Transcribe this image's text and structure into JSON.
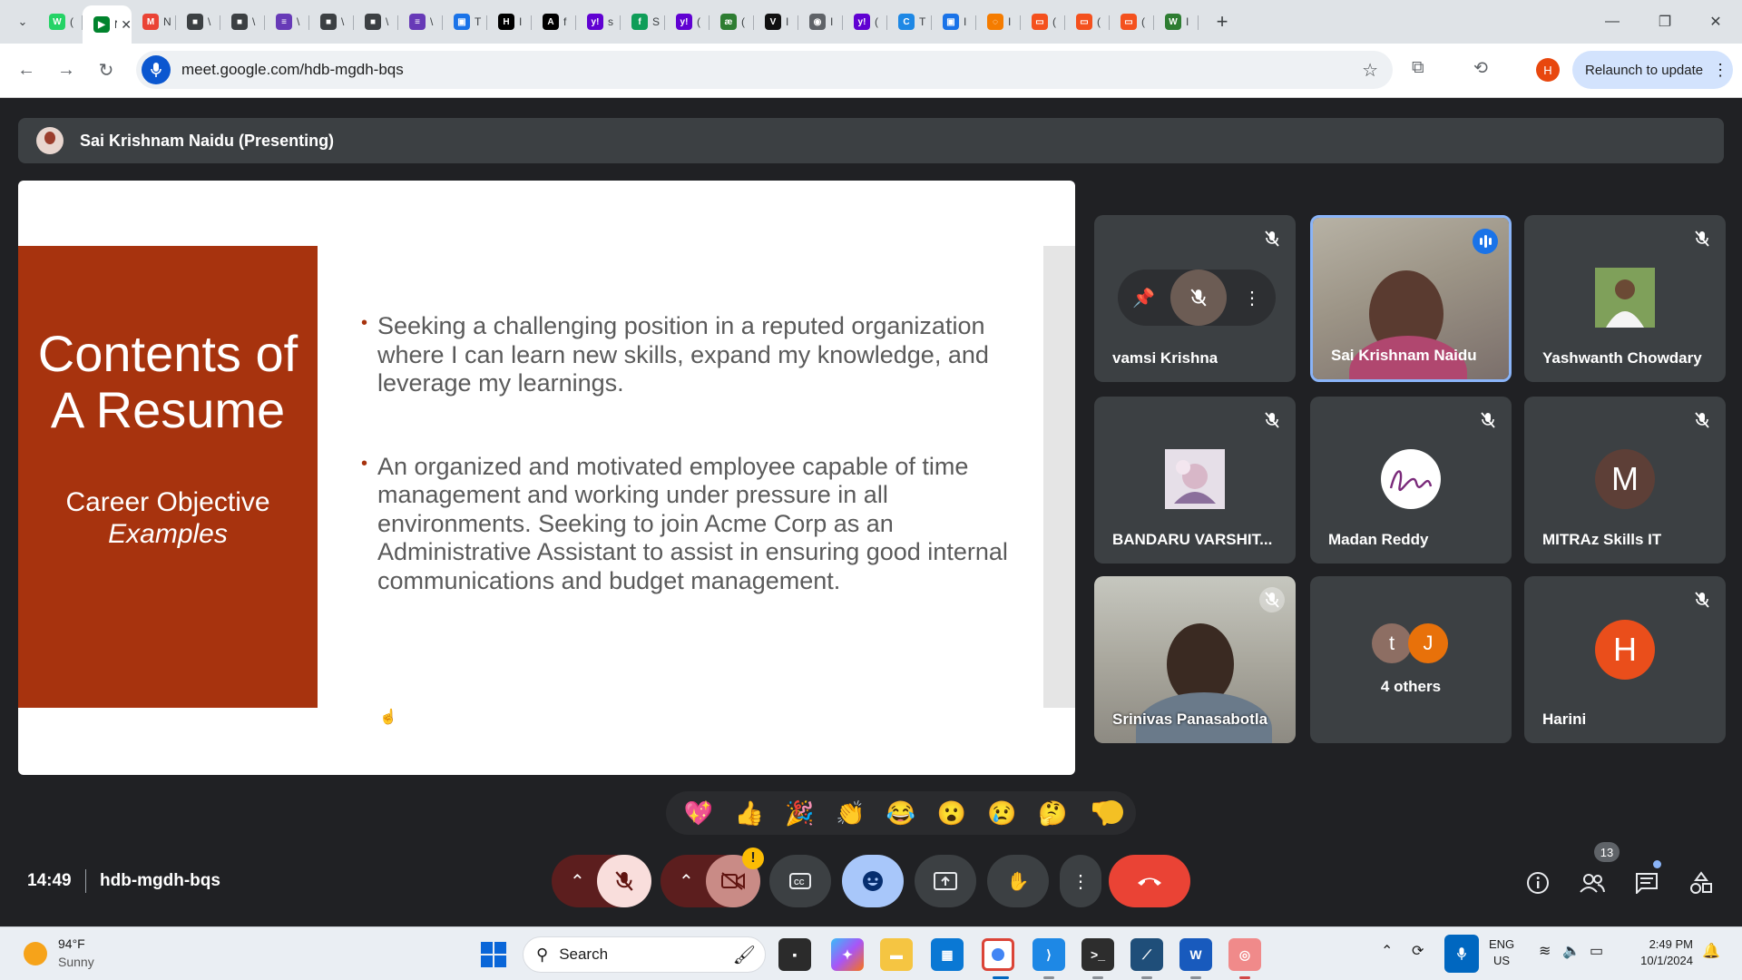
{
  "browser": {
    "tabs": [
      {
        "icon": "whatsapp-icon",
        "color": "#25d366",
        "glyph": "W",
        "title": "("
      },
      {
        "icon": "meet-icon",
        "color": "#00832d",
        "glyph": "▶",
        "title": "N",
        "active": true
      },
      {
        "icon": "gmail-icon",
        "color": "#ea4335",
        "glyph": "M",
        "title": "N"
      },
      {
        "icon": "profile-tab-icon",
        "color": "#3c4043",
        "glyph": "■",
        "title": "\\"
      },
      {
        "icon": "profile-tab-icon",
        "color": "#3c4043",
        "glyph": "■",
        "title": "\\"
      },
      {
        "icon": "forms-icon",
        "color": "#673ab7",
        "glyph": "≡",
        "title": "\\"
      },
      {
        "icon": "profile-tab-icon",
        "color": "#3c4043",
        "glyph": "■",
        "title": "\\"
      },
      {
        "icon": "profile-tab-icon",
        "color": "#3c4043",
        "glyph": "■",
        "title": "\\"
      },
      {
        "icon": "forms-icon",
        "color": "#673ab7",
        "glyph": "≡",
        "title": "\\"
      },
      {
        "icon": "printer-icon",
        "color": "#1a73e8",
        "glyph": "▣",
        "title": "T"
      },
      {
        "icon": "h-site-icon",
        "color": "#000000",
        "glyph": "H",
        "title": "I"
      },
      {
        "icon": "a-site-icon",
        "color": "#000000",
        "glyph": "A",
        "title": "f"
      },
      {
        "icon": "yahoo-icon",
        "color": "#6001d2",
        "glyph": "y!",
        "title": "s"
      },
      {
        "icon": "green-site-icon",
        "color": "#0f9d58",
        "glyph": "f",
        "title": "S"
      },
      {
        "icon": "yahoo-icon",
        "color": "#6001d2",
        "glyph": "y!",
        "title": "("
      },
      {
        "icon": "translate-icon",
        "color": "#2e7d32",
        "glyph": "æ",
        "title": "("
      },
      {
        "icon": "v-site-icon",
        "color": "#111111",
        "glyph": "V",
        "title": "I"
      },
      {
        "icon": "globe-icon",
        "color": "#5f6368",
        "glyph": "◉",
        "title": "I"
      },
      {
        "icon": "yahoo-icon",
        "color": "#6001d2",
        "glyph": "y!",
        "title": "("
      },
      {
        "icon": "c-site-icon",
        "color": "#1e88e5",
        "glyph": "C",
        "title": "T"
      },
      {
        "icon": "printer-icon",
        "color": "#1a73e8",
        "glyph": "▣",
        "title": "I"
      },
      {
        "icon": "ring-icon",
        "color": "#f57c00",
        "glyph": "◌",
        "title": "I"
      },
      {
        "icon": "slides-icon",
        "color": "#f4511e",
        "glyph": "▭",
        "title": "("
      },
      {
        "icon": "slides-icon",
        "color": "#f4511e",
        "glyph": "▭",
        "title": "("
      },
      {
        "icon": "slides-icon",
        "color": "#f4511e",
        "glyph": "▭",
        "title": "("
      },
      {
        "icon": "w-site-icon",
        "color": "#2e7d32",
        "glyph": "W",
        "title": "I"
      }
    ],
    "url": "meet.google.com/hdb-mgdh-bqs",
    "profile_initial": "H",
    "relaunch_label": "Relaunch to update"
  },
  "meet": {
    "presenter_label": "Sai Krishnam Naidu (Presenting)",
    "slide": {
      "title": "Contents of A Resume",
      "subtitle": "Career Objective",
      "subtitle_italic": "Examples",
      "bullets": [
        "Seeking a challenging position in a reputed organization where I can learn new skills, expand my knowledge, and leverage my learnings.",
        "An organized and motivated employee capable of time management and working under pressure in all environments. Seeking to join Acme Corp as an Administrative Assistant to assist in ensuring good internal communications and budget management."
      ]
    },
    "participants": [
      {
        "name": "vamsi Krishna",
        "muted": true,
        "hover": true
      },
      {
        "name": "Sai Krishnam Naidu",
        "speaking": true,
        "video": true
      },
      {
        "name": "Yashwanth Chowdary",
        "muted": true,
        "avatar": "photo"
      },
      {
        "name": "BANDARU VARSHIT...",
        "muted": true,
        "avatar": "photo"
      },
      {
        "name": "Madan Reddy",
        "muted": true,
        "avatar": "photo"
      },
      {
        "name": "MITRAz Skills IT",
        "muted": true,
        "initial": "M",
        "avatar_color": "#5d3f37"
      },
      {
        "name": "Srinivas Panasabotla",
        "muted": true,
        "video": true
      },
      {
        "name": "4 others",
        "others": [
          {
            "initial": "t",
            "color": "#8d6e63"
          },
          {
            "initial": "J",
            "color": "#e8710a"
          }
        ]
      },
      {
        "name": "Harini",
        "muted": true,
        "initial": "H",
        "avatar_color": "#ea4e1b"
      }
    ],
    "reactions": [
      "💖",
      "👍",
      "🎉",
      "👏",
      "😂",
      "😮",
      "😢",
      "🤔",
      "👎"
    ],
    "meeting_time": "14:49",
    "meeting_code": "hdb-mgdh-bqs",
    "people_count": "13",
    "warning_mark": "!"
  },
  "taskbar": {
    "temperature": "94°F",
    "condition": "Sunny",
    "search_placeholder": "Search",
    "lang_line1": "ENG",
    "lang_line2": "US",
    "time": "2:49 PM",
    "date": "10/1/2024"
  }
}
